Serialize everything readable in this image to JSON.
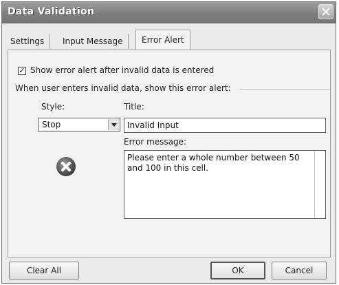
{
  "window": {
    "title": "Data Validation"
  },
  "tabs": [
    {
      "label": "Settings"
    },
    {
      "label": "Input Message"
    },
    {
      "label": "Error Alert"
    }
  ],
  "error_alert": {
    "show_alert_checkbox": {
      "checked": true,
      "label": "Show error alert after invalid data is entered"
    },
    "group_label": "When user enters invalid data, show this error alert:",
    "style_label": "Style:",
    "style_value": "Stop",
    "style_icon": "stop-icon",
    "title_label": "Title:",
    "title_value": "Invalid Input",
    "message_label": "Error message:",
    "message_value": "Please enter a whole number between 50 and 100 in this cell."
  },
  "buttons": {
    "clear_all": "Clear All",
    "ok": "OK",
    "cancel": "Cancel"
  }
}
